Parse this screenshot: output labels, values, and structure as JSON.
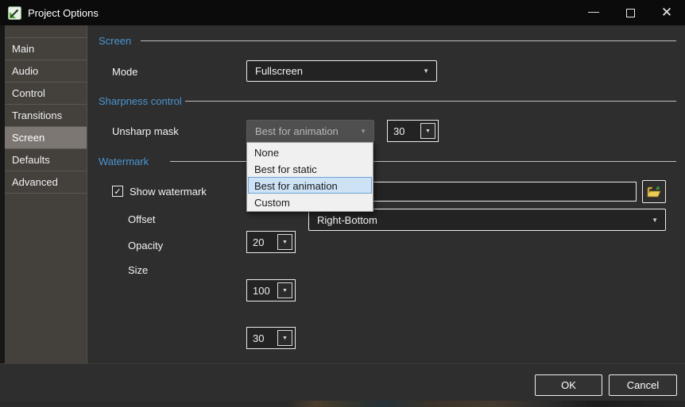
{
  "window": {
    "title": "Project Options",
    "minimize_glyph": "—",
    "close_glyph": "✕"
  },
  "sidebar": {
    "items": [
      {
        "label": "Main",
        "selected": false
      },
      {
        "label": "Audio",
        "selected": false
      },
      {
        "label": "Control",
        "selected": false
      },
      {
        "label": "Transitions",
        "selected": false
      },
      {
        "label": "Screen",
        "selected": true
      },
      {
        "label": "Defaults",
        "selected": false
      },
      {
        "label": "Advanced",
        "selected": false
      }
    ]
  },
  "sections": {
    "screen": {
      "title": "Screen",
      "mode_label": "Mode",
      "mode_value": "Fullscreen"
    },
    "sharpness": {
      "title": "Sharpness control",
      "unsharp_label": "Unsharp mask",
      "unsharp_value": "Best for animation",
      "unsharp_amount": "30",
      "dropdown_open": true,
      "dropdown_options": [
        {
          "label": "None",
          "selected": false
        },
        {
          "label": "Best for static",
          "selected": false
        },
        {
          "label": "Best for animation",
          "selected": true
        },
        {
          "label": "Custom",
          "selected": false
        }
      ]
    },
    "watermark": {
      "title": "Watermark",
      "show_label": "Show watermark",
      "show_checked": true,
      "check_glyph": "✓",
      "file_value": "",
      "offset_label": "Offset",
      "offset_value": "20",
      "position_value": "Right-Bottom",
      "opacity_label": "Opacity",
      "opacity_value": "100",
      "size_label": "Size",
      "size_value": "30"
    }
  },
  "glyphs": {
    "dropdown_arrow": "▼"
  },
  "footer": {
    "ok": "OK",
    "cancel": "Cancel"
  },
  "colors": {
    "titlebar": "#0b0b0b",
    "content_bg": "#2e2e2e",
    "sidebar_bg": "#44403c",
    "sidebar_selected": "#7c7772",
    "section_header": "#4a96d2",
    "control_border": "#ececec",
    "control_bg": "#232323",
    "list_bg": "#f0f0f0",
    "list_highlight": "#cde2f5",
    "list_highlight_border": "#6ea3d8"
  }
}
